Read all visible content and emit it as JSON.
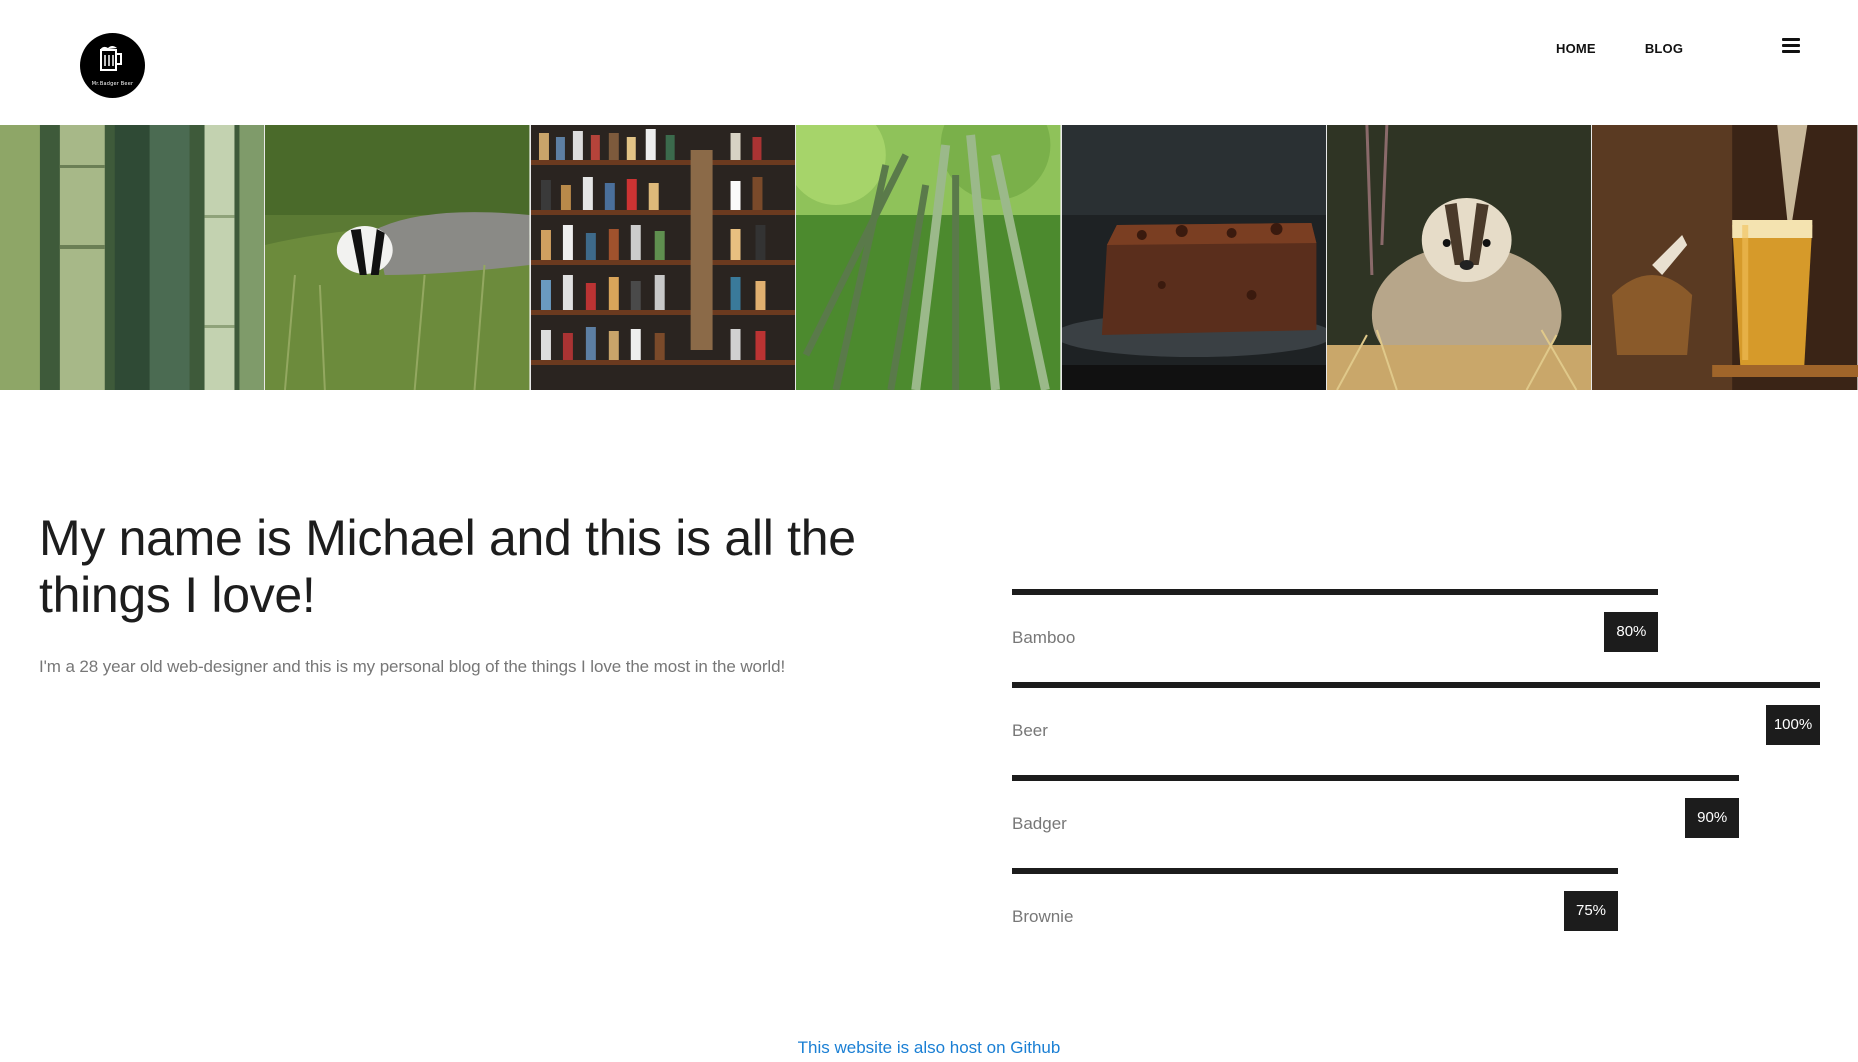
{
  "header": {
    "logo_text": "Mr.Badger Beer",
    "nav": {
      "home": "HOME",
      "blog": "BLOG"
    }
  },
  "gallery": [
    "bamboo-stalks",
    "badger-in-grass",
    "beer-shelf",
    "bamboo-forest",
    "brownie",
    "badger-portrait",
    "beer-glass"
  ],
  "intro": {
    "title": "My name is Michael and this is all the things I love!",
    "text": "I'm a 28 year old web-designer and this is my personal blog of the things I love the most in the world!"
  },
  "skills": [
    {
      "label": "Bamboo",
      "value": "80%",
      "fraction": 0.8
    },
    {
      "label": "Beer",
      "value": "100%",
      "fraction": 1.0
    },
    {
      "label": "Badger",
      "value": "90%",
      "fraction": 0.9
    },
    {
      "label": "Brownie",
      "value": "75%",
      "fraction": 0.75
    }
  ],
  "footer": {
    "link": "This website is also host on Github"
  },
  "colors": {
    "bar": "#1c1c1c",
    "link": "#1a7fd4"
  }
}
